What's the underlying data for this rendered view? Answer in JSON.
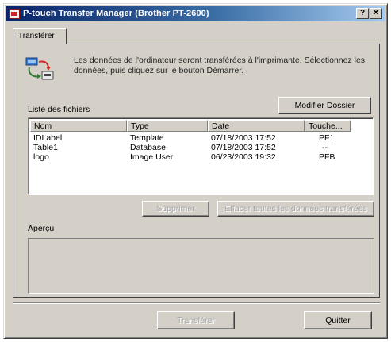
{
  "window": {
    "title": "P-touch Transfer Manager (Brother PT-2600)",
    "help_label": "?",
    "close_label": "✕"
  },
  "tab": {
    "label": "Transférer"
  },
  "info": {
    "icon": "transfer-icon",
    "text": "Les données de l'ordinateur seront transférées à l'imprimante. Sélectionnez les données, puis cliquez sur le bouton Démarrer."
  },
  "buttons": {
    "modify_folder": "Modifier Dossier",
    "delete": "Supprimer",
    "delete_all": "Effacer toutes les données transférées",
    "transfer": "Transférer",
    "quit": "Quitter"
  },
  "files": {
    "label": "Liste des fichiers",
    "columns": [
      "Nom",
      "Type",
      "Date",
      "Touche..."
    ],
    "rows": [
      [
        "IDLabel",
        "Template",
        "07/18/2003 17:52",
        "PF1"
      ],
      [
        "Table1",
        "Database",
        "07/18/2003 17:52",
        "--"
      ],
      [
        "logo",
        "Image User",
        "06/23/2003 19:32",
        "PFB"
      ]
    ]
  },
  "preview": {
    "label": "Aperçu"
  }
}
